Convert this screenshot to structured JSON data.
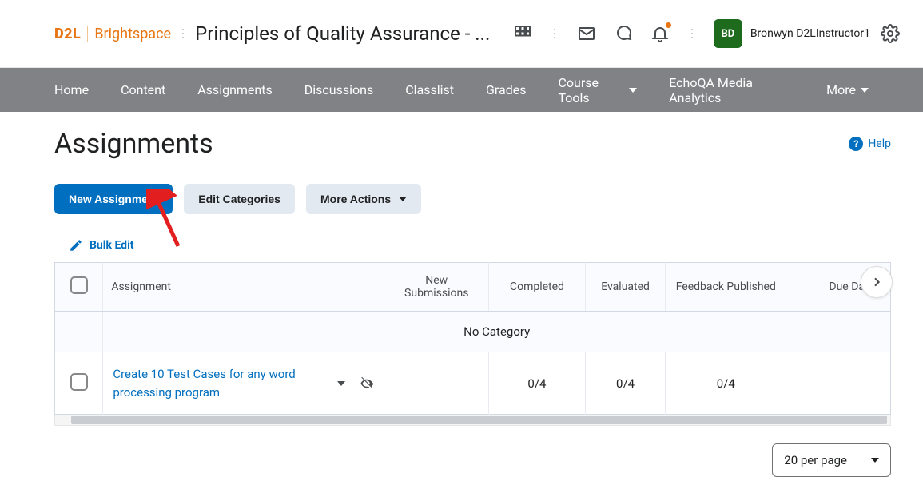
{
  "brand": {
    "d2l": "D2L",
    "brightspace": "Brightspace"
  },
  "courseTitle": "Principles of Quality Assurance - ...",
  "user": {
    "initials": "BD",
    "name": "Bronwyn D2LInstructor1"
  },
  "nav": {
    "home": "Home",
    "content": "Content",
    "assignments": "Assignments",
    "discussions": "Discussions",
    "classlist": "Classlist",
    "grades": "Grades",
    "courseTools": "Course Tools",
    "echoqa": "EchoQA Media Analytics",
    "more": "More"
  },
  "page": {
    "title": "Assignments",
    "help": "Help",
    "newAssignment": "New Assignment",
    "editCategories": "Edit Categories",
    "moreActions": "More Actions",
    "bulkEdit": "Bulk Edit"
  },
  "table": {
    "headers": {
      "assignment": "Assignment",
      "newSubmissions": "New Submissions",
      "completed": "Completed",
      "evaluated": "Evaluated",
      "feedback": "Feedback Published",
      "dueDate": "Due Date"
    },
    "category": "No Category",
    "row": {
      "title": "Create 10 Test Cases for any word processing program",
      "completed": "0/4",
      "evaluated": "0/4",
      "feedback": "0/4"
    }
  },
  "perPage": "20 per page"
}
